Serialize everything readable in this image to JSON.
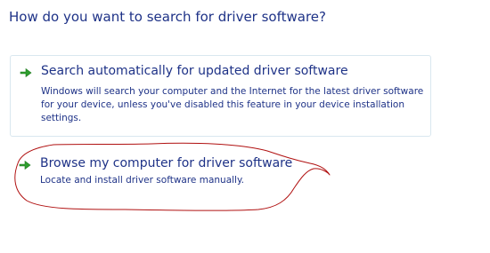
{
  "heading": "How do you want to search for driver software?",
  "options": [
    {
      "title": "Search automatically for updated driver software",
      "description": "Windows will search your computer and the Internet for the latest driver software for your device, unless you've disabled this feature in your device installation settings.",
      "icon": "green-arrow-icon"
    },
    {
      "title": "Browse my computer for driver software",
      "description": "Locate and install driver software manually.",
      "icon": "green-arrow-icon"
    }
  ],
  "colors": {
    "text": "#1e3287",
    "arrow": "#2e9e2e",
    "highlight_border": "#d9e7ef",
    "annotation": "#b01010"
  }
}
